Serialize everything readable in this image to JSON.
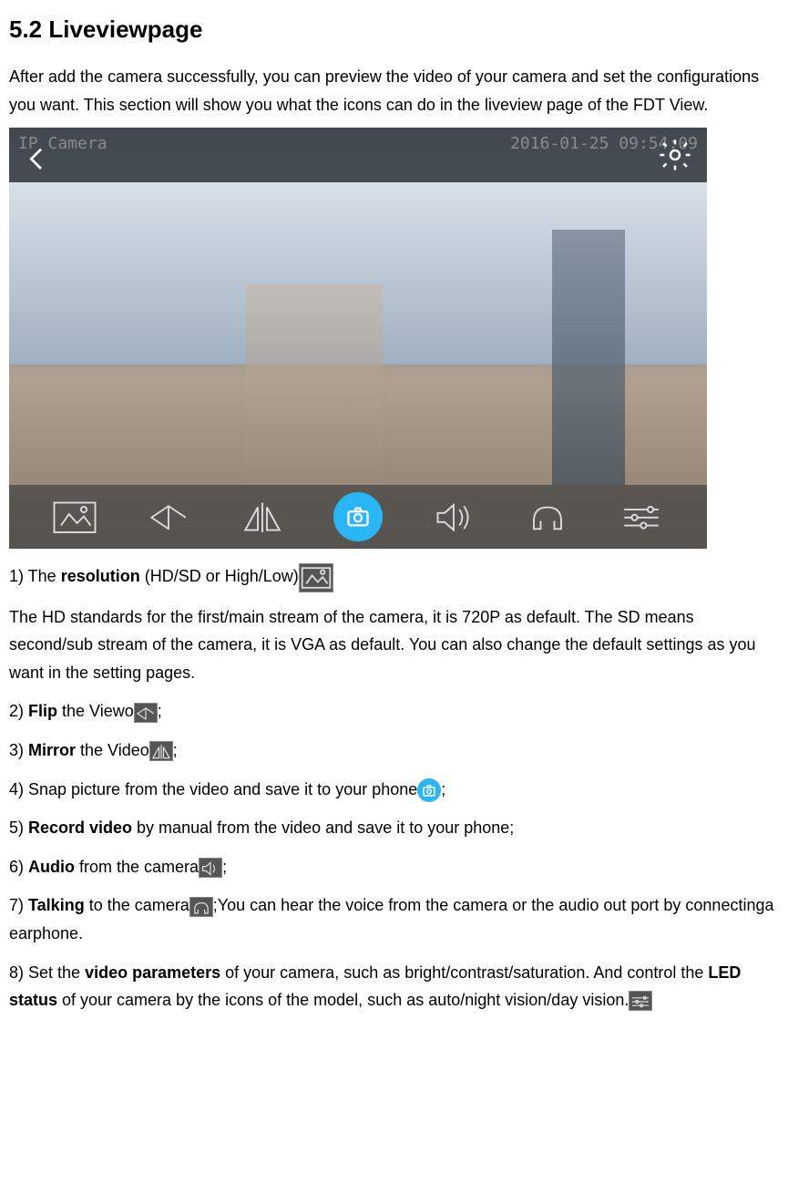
{
  "heading": "5.2 Liveviewpage",
  "intro": "After add the camera successfully, you can preview the video of your camera and set the configurations you want. This section will show you what the icons can do in the liveview page of the FDT View.",
  "screenshot": {
    "cameraLabel": "IP Camera",
    "timestamp": "2016-01-25 09:54:09"
  },
  "item1": {
    "prefix": "1) The ",
    "bold": "resolution",
    "suffix": " (HD/SD or High/Low)"
  },
  "item1_desc": "The HD standards for the first/main stream of the camera, it is 720P as default. The SD means second/sub stream of the camera, it is VGA as default. You can also change the default settings as you want in the setting pages.",
  "item2": {
    "prefix": "2) ",
    "bold": "Flip",
    "suffix": " the Viewo",
    "tail": ";"
  },
  "item3": {
    "prefix": "3) ",
    "bold": "Mirror",
    "suffix": " the Video",
    "tail": ";"
  },
  "item4": {
    "text": "4) Snap picture from the video and save it to your phone",
    "tail": ";"
  },
  "item5": {
    "prefix": "5) ",
    "bold": "Record video",
    "suffix": " by manual from the video and save it to your phone;"
  },
  "item6": {
    "prefix": "6) ",
    "bold": "Audio",
    "suffix": " from the camera",
    "tail": ";"
  },
  "item7": {
    "prefix": "7) ",
    "bold": "Talking",
    "suffix": " to the camera",
    "tail": ";You can hear the voice from the camera or the audio out port by connectinga earphone."
  },
  "item8": {
    "p1": "8) Set the ",
    "b1": "video parameters",
    "p2": " of your camera, such as bright/contrast/saturation. And control the ",
    "b2": "LED status",
    "p3": " of your camera by the icons of the model, such as auto/night vision/day vision."
  }
}
